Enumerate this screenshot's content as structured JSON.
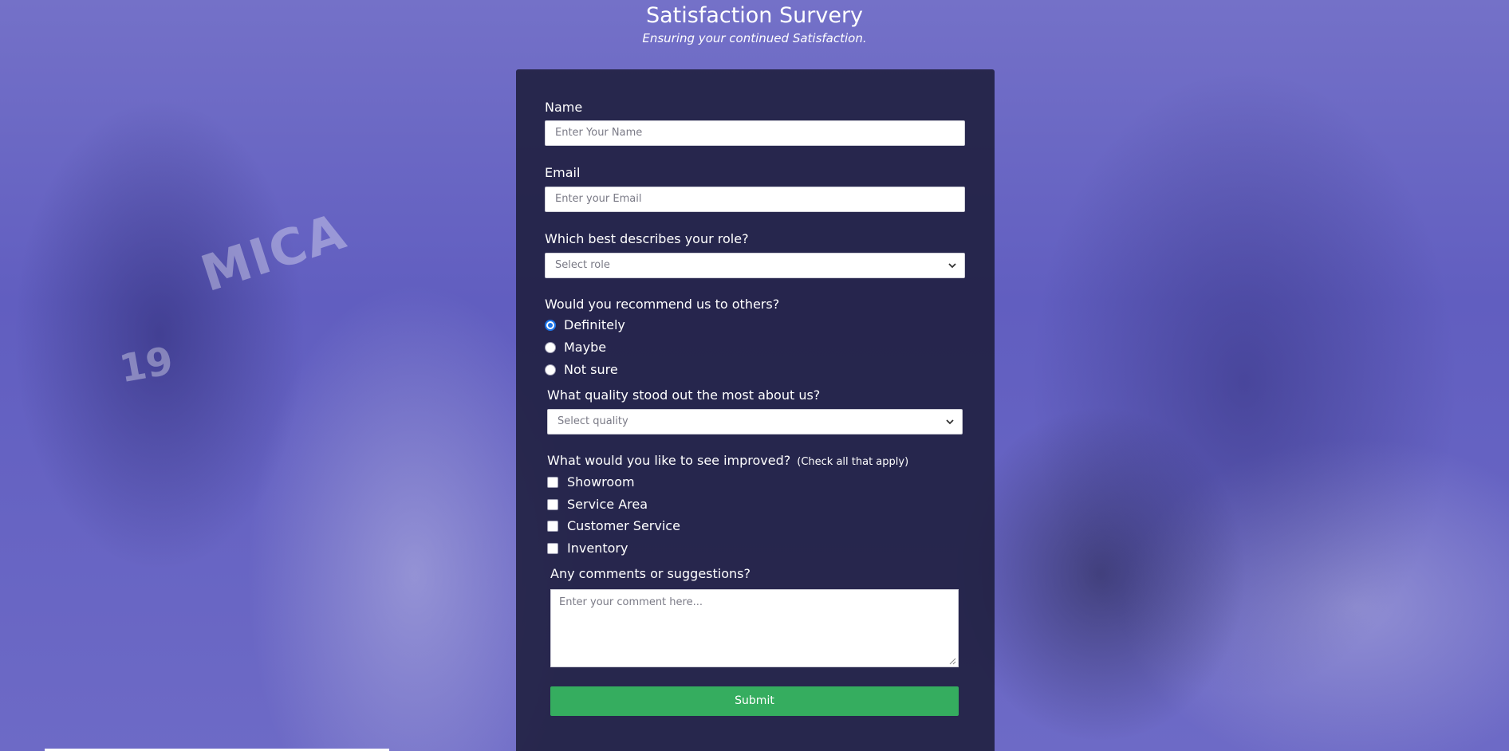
{
  "header": {
    "title": "Satisfaction Survery",
    "subtitle": "Ensuring your continued Satisfaction."
  },
  "form": {
    "name_label": "Name",
    "name_placeholder": "Enter Your Name",
    "email_label": "Email",
    "email_placeholder": "Enter your Email",
    "role_label": "Which best describes your role?",
    "role_value": "Select role",
    "recommend_label": "Would you recommend us to others?",
    "recommend_options": [
      {
        "label": "Definitely",
        "checked": true
      },
      {
        "label": "Maybe",
        "checked": false
      },
      {
        "label": "Not sure",
        "checked": false
      }
    ],
    "quality_label": "What quality stood out the most about us?",
    "quality_value": "Select quality",
    "improve_label": "What would you like to see improved?",
    "improve_hint": "(Check all that apply)",
    "improve_options": [
      "Showroom",
      "Service Area",
      "Customer Service",
      "Inventory"
    ],
    "comments_label": "Any comments or suggestions?",
    "comments_placeholder": "Enter your comment here...",
    "submit_label": "Submit"
  },
  "colors": {
    "panel_bg": "#1e1e3c",
    "submit_bg": "#35ad5f",
    "background_tint": "#615ec0",
    "radio_accent": "#1a73e8"
  },
  "icons": [
    "chevron-down-icon",
    "resize-grip-icon"
  ],
  "background_text": {
    "shirt_text": "MICA",
    "shirt_number": "19"
  }
}
